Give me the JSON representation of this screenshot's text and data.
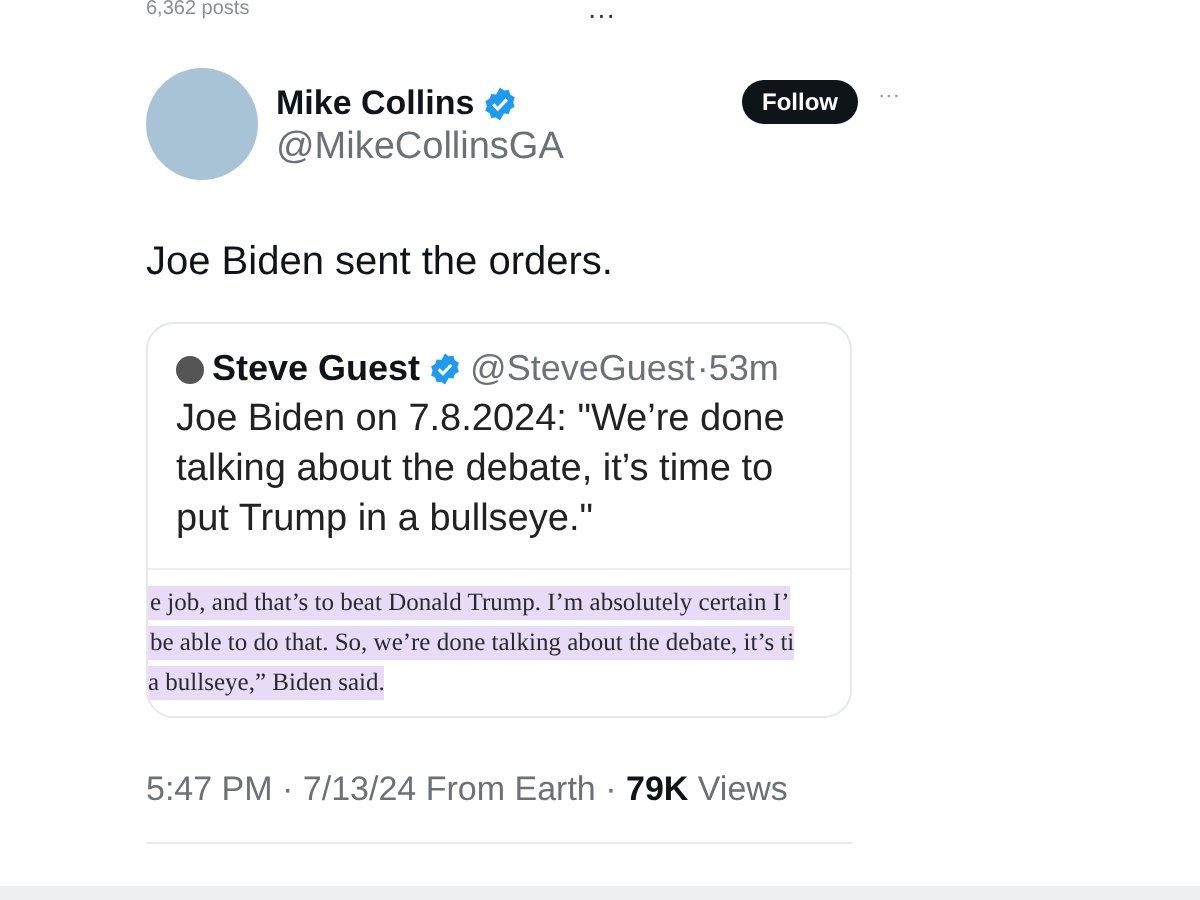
{
  "header": {
    "post_count": "6,362 posts",
    "more": "···"
  },
  "post": {
    "author": {
      "name": "Mike Collins",
      "handle": "@MikeCollinsGA",
      "verified": true
    },
    "follow_button": "Follow",
    "more": "···",
    "text": "Joe Biden sent the orders.",
    "quote": {
      "author": {
        "name": "Steve Guest",
        "handle": "@SteveGuest",
        "verified": true
      },
      "time": "·53m",
      "text": "Joe Biden on 7.8.2024: \"We’re done talking about the debate, it’s time to put Trump in a bullseye.\"",
      "excerpt_lines": [
        "e job, and that’s to beat Donald Trump. I’m absolutely certain I’",
        "be able to do that. So, we’re done talking about the debate, it’s ti",
        "a bullseye,” Biden said."
      ]
    },
    "meta": "5:47 PM · 7/13/24 From Earth · **79K** Views"
  }
}
